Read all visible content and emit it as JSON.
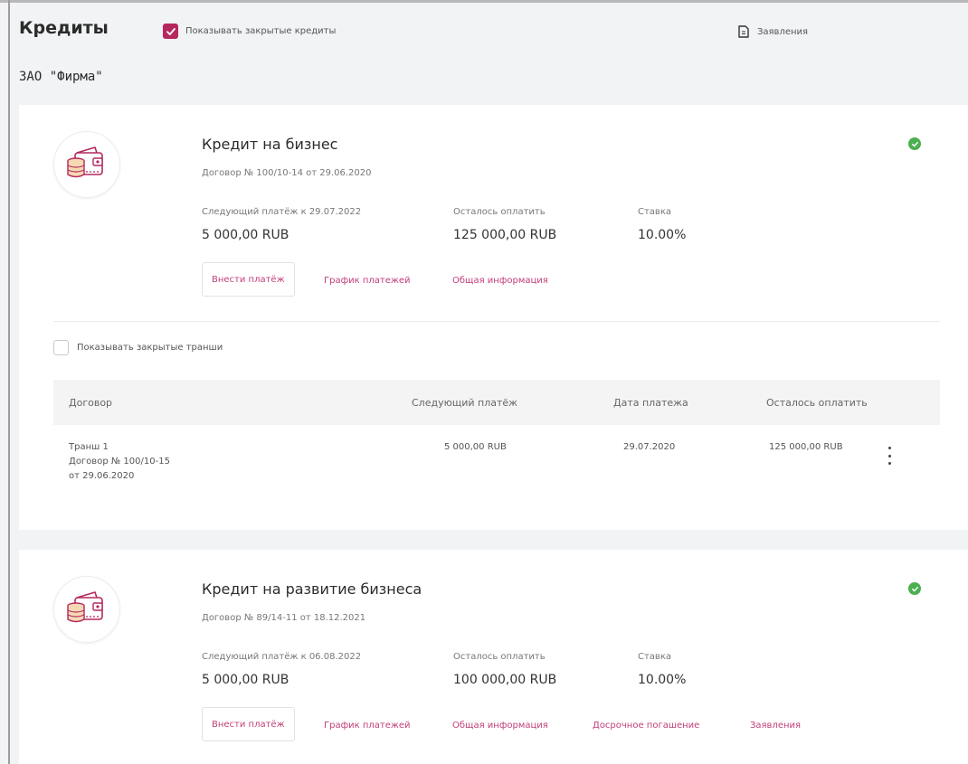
{
  "header": {
    "title": "Кредиты",
    "show_closed_label": "Показывать закрытые кредиты",
    "show_closed_checked": true,
    "statements_label": "Заявления",
    "statements_icon": "document-icon"
  },
  "company": "ЗАО \"Фирма\"",
  "colors": {
    "accent": "#b4285f",
    "link": "#c2407a",
    "status_ok": "#4caf50"
  },
  "loans": [
    {
      "title": "Кредит на бизнес",
      "contract": "Договор № 100/10-14 от 29.06.2020",
      "status": "ok",
      "next_payment_label": "Следующий платёж к 29.07.2022",
      "next_payment_value": "5 000,00 RUB",
      "remaining_label": "Осталось оплатить",
      "remaining_value": "125 000,00 RUB",
      "rate_label": "Ставка",
      "rate_value": "10.00%",
      "actions": {
        "pay": "Внести платёж",
        "schedule": "График платежей",
        "info": "Общая информация"
      },
      "tranches": {
        "show_closed_label": "Показывать закрытые транши",
        "show_closed_checked": false,
        "columns": [
          "Договор",
          "Следующий платёж",
          "Дата платежа",
          "Осталось оплатить"
        ],
        "rows": [
          {
            "name": "Транш 1",
            "contract": "Договор № 100/10-15",
            "date": "от 29.06.2020",
            "next_payment": "5 000,00 RUB",
            "payment_date": "29.07.2020",
            "remaining": "125 000,00 RUB"
          }
        ]
      }
    },
    {
      "title": "Кредит на развитие бизнеса",
      "contract": "Договор № 89/14-11 от 18.12.2021",
      "status": "ok",
      "next_payment_label": "Следующий платёж к 06.08.2022",
      "next_payment_value": "5 000,00 RUB",
      "remaining_label": "Осталось оплатить",
      "remaining_value": "100 000,00 RUB",
      "rate_label": "Ставка",
      "rate_value": "10.00%",
      "actions": {
        "pay": "Внести платёж",
        "schedule": "График платежей",
        "info": "Общая информация",
        "early": "Досрочное погашение",
        "statements": "Заявления"
      }
    }
  ]
}
